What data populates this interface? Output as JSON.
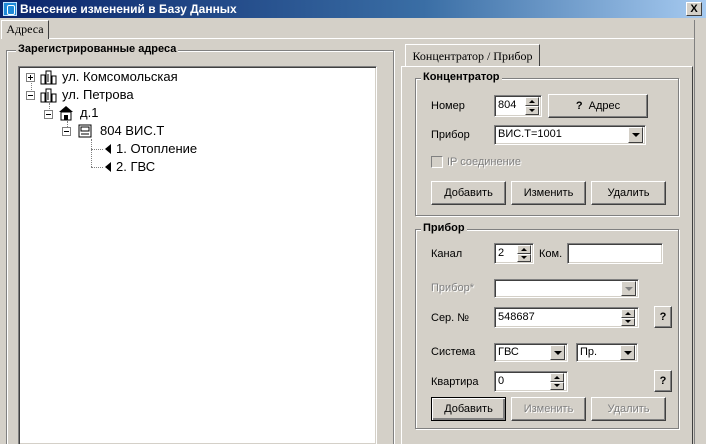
{
  "window": {
    "title": "Внесение изменений в Базу Данных",
    "close_label": "X"
  },
  "main_tab": {
    "label": "Адреса"
  },
  "tree_panel": {
    "title": "Зарегистрированные адреса",
    "nodes": [
      {
        "label": "ул. Комсомольская",
        "icon": "buildings-icon",
        "expanded": false
      },
      {
        "label": "ул. Петрова",
        "icon": "buildings-icon",
        "expanded": true
      },
      {
        "label": "д.1",
        "icon": "house-icon",
        "expanded": true
      },
      {
        "label": "804 ВИС.Т",
        "icon": "device-icon",
        "expanded": true
      },
      {
        "label": "1. Отопление",
        "icon": "channel-arrow-icon"
      },
      {
        "label": "2. ГВС",
        "icon": "channel-arrow-icon"
      }
    ]
  },
  "right_tab": {
    "label": "Концентратор / Прибор"
  },
  "concentrator": {
    "title": "Концентратор",
    "number_label": "Номер",
    "number_value": "804",
    "address_button": "Адрес",
    "address_button_glyph": "?",
    "device_label": "Прибор",
    "device_value": "ВИС.Т=1001",
    "ip_label": "IP соединение",
    "add_button": "Добавить",
    "edit_button": "Изменить",
    "delete_button": "Удалить"
  },
  "device": {
    "title": "Прибор",
    "channel_label": "Канал",
    "channel_value": "2",
    "com_label": "Ком.",
    "com_value": "",
    "device_label": "Прибор*",
    "device_value": "",
    "serial_label": "Сер. №",
    "serial_value": "548687",
    "serial_help": "?",
    "system_label": "Система",
    "system_value": "ГВС",
    "system2_value": "Пр.",
    "apartment_label": "Квартира",
    "apartment_value": "0",
    "apartment_help": "?",
    "add_button": "Добавить",
    "edit_button": "Изменить",
    "delete_button": "Удалить"
  }
}
